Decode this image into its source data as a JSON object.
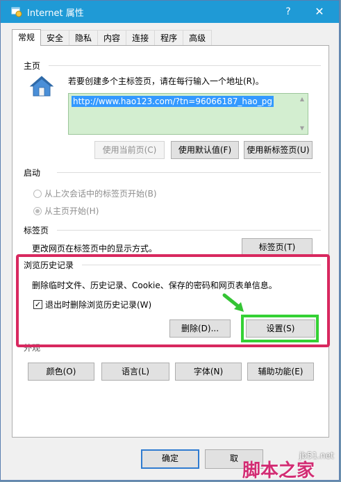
{
  "window": {
    "title": "Internet 属性",
    "help": "?",
    "close": "✕"
  },
  "tabs": [
    "常规",
    "安全",
    "隐私",
    "内容",
    "连接",
    "程序",
    "高级"
  ],
  "homepage": {
    "header": "主页",
    "instruction": "若要创建多个主标签页，请在每行输入一个地址(R)。",
    "url": "http://www.hao123.com/?tn=96066187_hao_pg",
    "buttons": {
      "current": "使用当前页(C)",
      "default": "使用默认值(F)",
      "newtab": "使用新标签页(U)"
    }
  },
  "startup": {
    "header": "启动",
    "option_last": "从上次会话中的标签页开始(B)",
    "option_home": "从主页开始(H)"
  },
  "tabs_section": {
    "header": "标签页",
    "text": "更改网页在标签页中的显示方式。",
    "button": "标签页(T)"
  },
  "history": {
    "header": "浏览历史记录",
    "text": "删除临时文件、历史记录、Cookie、保存的密码和网页表单信息。",
    "checkbox": "退出时删除浏览历史记录(W)",
    "checkbox_checked": true,
    "delete_button": "删除(D)...",
    "settings_button": "设置(S)"
  },
  "appearance": {
    "header_partial": "外观",
    "buttons": [
      "颜色(O)",
      "语言(L)",
      "字体(N)",
      "辅助功能(E)"
    ]
  },
  "footer": {
    "ok": "确定",
    "cancel": "取"
  },
  "watermark": {
    "brand": "脚本之家",
    "site": "jb51.net"
  },
  "colors": {
    "titlebar": "#1f9ad6",
    "highlight": "#d8285f",
    "green": "#34d134",
    "url_bg": "#d3eed0"
  }
}
